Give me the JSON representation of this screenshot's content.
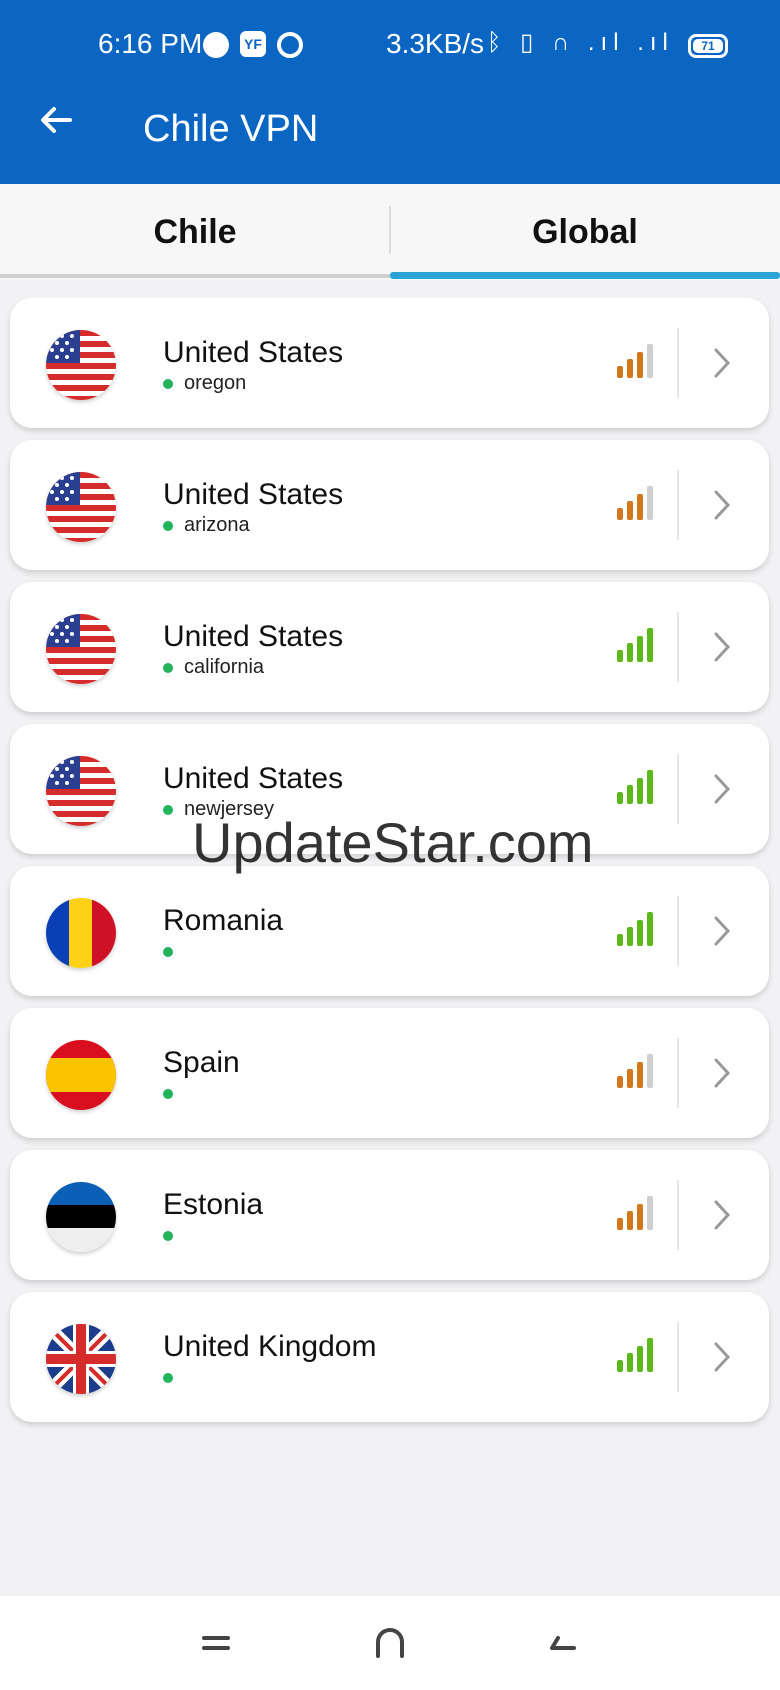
{
  "status_bar": {
    "time": "6:16 PM",
    "speed": "3.3KB/s",
    "badge": "YF",
    "indicators": "ᛒ ▯ ∩ .ıl .ıl",
    "battery": "71"
  },
  "app_bar": {
    "title": "Chile VPN"
  },
  "tabs": [
    {
      "label": "Chile",
      "active": false
    },
    {
      "label": "Global",
      "active": true
    }
  ],
  "servers": [
    {
      "country": "United States",
      "region": "oregon",
      "flag": "us-flag-icon",
      "signal_color": "#d2781c"
    },
    {
      "country": "United States",
      "region": "arizona",
      "flag": "us-flag-icon",
      "signal_color": "#d2781c"
    },
    {
      "country": "United States",
      "region": "california",
      "flag": "us-flag-icon",
      "signal_color": "#5cb81a"
    },
    {
      "country": "United States",
      "region": "newjersey",
      "flag": "us-flag-icon",
      "signal_color": "#5cb81a"
    },
    {
      "country": "Romania",
      "region": "",
      "flag": "romania-flag-icon",
      "signal_color": "#5cb81a"
    },
    {
      "country": "Spain",
      "region": "",
      "flag": "spain-flag-icon",
      "signal_color": "#d2781c"
    },
    {
      "country": "Estonia",
      "region": "",
      "flag": "estonia-flag-icon",
      "signal_color": "#d2781c"
    },
    {
      "country": "United Kingdom",
      "region": "",
      "flag": "uk-flag-icon",
      "signal_color": "#5cb81a"
    }
  ],
  "watermark": "UpdateStar.com",
  "colors": {
    "primary": "#0a66c2",
    "tab_indicator": "#2ba3d5",
    "online_dot": "#22b35a"
  }
}
